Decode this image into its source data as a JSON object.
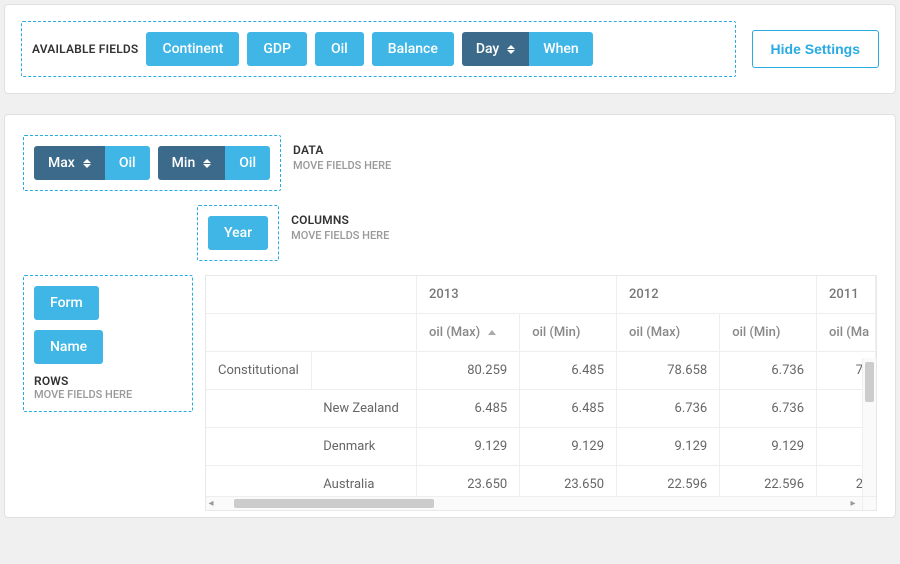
{
  "top": {
    "available_label": "AVAILABLE FIELDS",
    "fields": [
      "Continent",
      "GDP",
      "Oil",
      "Balance"
    ],
    "day_chip": {
      "label": "Day",
      "adjacent": "When"
    },
    "hide_settings": "Hide Settings"
  },
  "config": {
    "data": {
      "label": "DATA",
      "hint": "MOVE FIELDS HERE",
      "items": [
        {
          "agg": "Max",
          "field": "Oil"
        },
        {
          "agg": "Min",
          "field": "Oil"
        }
      ]
    },
    "columns": {
      "label": "COLUMNS",
      "hint": "MOVE FIELDS HERE",
      "items": [
        "Year"
      ]
    },
    "rows": {
      "label": "ROWS",
      "hint": "MOVE FIELDS HERE",
      "items": [
        "Form",
        "Name"
      ]
    }
  },
  "pivot": {
    "years": [
      "2013",
      "2012",
      "2011"
    ],
    "col_headers": [
      {
        "label": "oil (Max)",
        "sorted": true
      },
      {
        "label": "oil (Min)"
      },
      {
        "label": "oil (Max)"
      },
      {
        "label": "oil (Min)"
      },
      {
        "label": "oil (Ma"
      }
    ],
    "rows": [
      {
        "group": "Constitutional",
        "name": "",
        "v": [
          "80.259",
          "6.485",
          "78.658",
          "6.736",
          "7"
        ]
      },
      {
        "group": "",
        "name": "New Zealand",
        "v": [
          "6.485",
          "6.485",
          "6.736",
          "6.736",
          ""
        ]
      },
      {
        "group": "",
        "name": "Denmark",
        "v": [
          "9.129",
          "9.129",
          "9.129",
          "9.129",
          ""
        ]
      },
      {
        "group": "",
        "name": "Australia",
        "v": [
          "23.650",
          "23.650",
          "22.596",
          "22.596",
          "2"
        ]
      }
    ]
  }
}
